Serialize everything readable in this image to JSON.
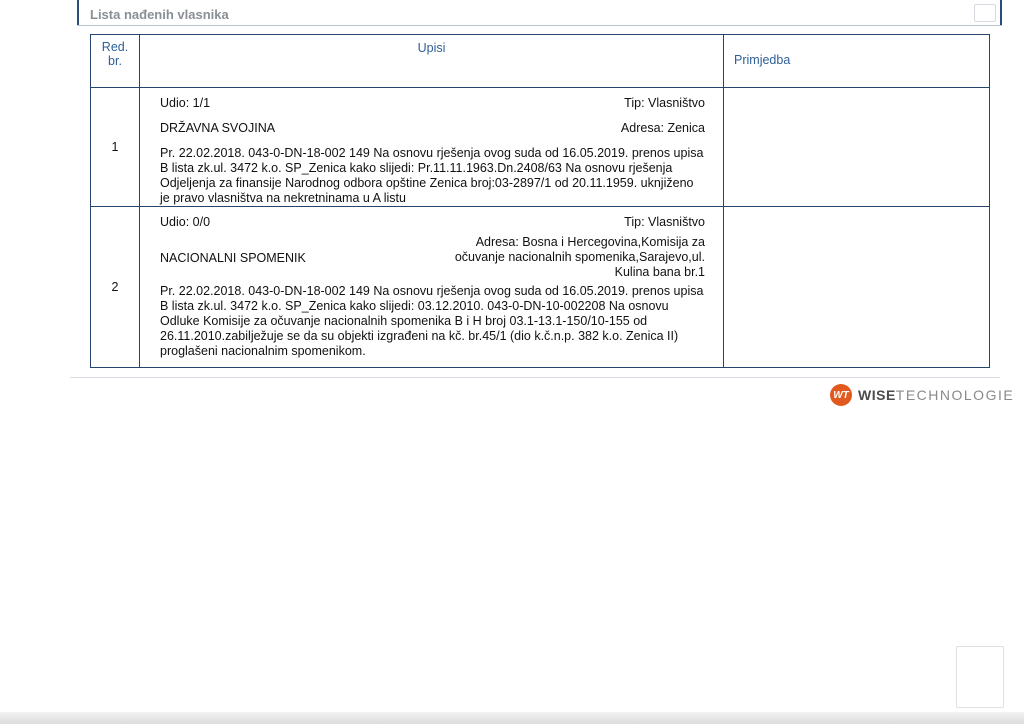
{
  "section": {
    "title": "Lista nađenih vlasnika"
  },
  "table": {
    "headers": {
      "red_line1": "Red.",
      "red_line2": "br.",
      "upisi": "Upisi",
      "primjedba": "Primjedba"
    },
    "rows": [
      {
        "number": "1",
        "udio": "Udio: 1/1",
        "tip": "Tip: Vlasništvo",
        "owner": "DRŽAVNA SVOJINA",
        "adresa": "Adresa: Zenica",
        "text": "Pr. 22.02.2018. 043-0-DN-18-002 149 Na osnovu rješenja ovog suda od 16.05.2019. prenos upisa B lista zk.ul. 3472 k.o. SP_Zenica kako slijedi: Pr.11.11.1963.Dn.2408/63 Na osnovu rješenja Odjeljenja za finansije Narodnog odbora opštine Zenica broj:03-2897/1 od 20.11.1959. uknjiženo je pravo vlasništva na nekretninama u A listu",
        "primjedba": ""
      },
      {
        "number": "2",
        "udio": "Udio: 0/0",
        "tip": "Tip: Vlasništvo",
        "owner": "NACIONALNI SPOMENIK",
        "adresa_line1": "Adresa: Bosna i Hercegovina,Komisija za",
        "adresa_line2": "očuvanje nacionalnih spomenika,Sarajevo,ul.",
        "adresa_line3": "Kulina bana br.1",
        "text": "Pr. 22.02.2018. 043-0-DN-18-002 149 Na osnovu rješenja ovog suda od 16.05.2019. prenos upisa B lista zk.ul. 3472 k.o. SP_Zenica kako slijedi: 03.12.2010. 043-0-DN-10-002208 Na osnovu Odluke Komisije za očuvanje nacionalnih spomenika B i H broj 03.1-13.1-150/10-155 od 26.11.2010.zabilježuje se da su objekti izgrađeni na kč. br.45/1 (dio k.č.n.p. 382 k.o. Zenica II) proglašeni nacionalnim spomenikom.",
        "primjedba": ""
      }
    ]
  },
  "logo": {
    "mark": "WT",
    "word1": "WISE",
    "word2": "TECHNOLOGIE",
    "mark_color": "#e2591f"
  }
}
